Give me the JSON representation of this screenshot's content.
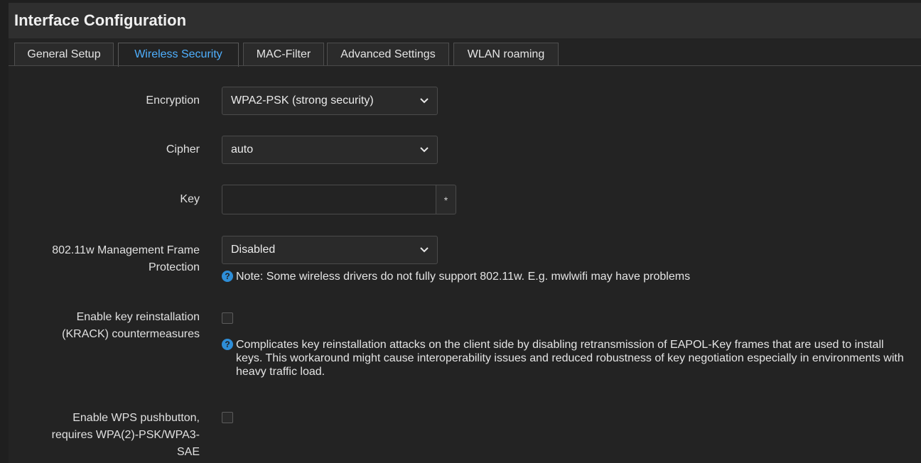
{
  "title": "Interface Configuration",
  "tabs": [
    {
      "label": "General Setup"
    },
    {
      "label": "Wireless Security"
    },
    {
      "label": "MAC-Filter"
    },
    {
      "label": "Advanced Settings"
    },
    {
      "label": "WLAN roaming"
    }
  ],
  "active_tab": "Wireless Security",
  "form": {
    "encryption": {
      "label": "Encryption",
      "value": "WPA2-PSK (strong security)"
    },
    "cipher": {
      "label": "Cipher",
      "value": "auto"
    },
    "key": {
      "label": "Key",
      "value": "",
      "reveal_label": "*"
    },
    "mfp": {
      "label_line1": "802.11w Management Frame",
      "label_line2": "Protection",
      "value": "Disabled",
      "help": "Note: Some wireless drivers do not fully support 802.11w. E.g. mwlwifi may have problems"
    },
    "krack": {
      "label_line1": "Enable key reinstallation",
      "label_line2": "(KRACK) countermeasures",
      "checked": false,
      "help": "Complicates key reinstallation attacks on the client side by disabling retransmission of EAPOL-Key frames that are used to install keys. This workaround might cause interoperability issues and reduced robustness of key negotiation especially in environments with heavy traffic load."
    },
    "wps": {
      "label_line1": "Enable WPS pushbutton,",
      "label_line2": "requires WPA(2)-PSK/WPA3-",
      "label_line3": "SAE",
      "checked": false
    }
  },
  "colors": {
    "accent": "#4fb0ff",
    "help_icon": "#2e8ed8"
  }
}
